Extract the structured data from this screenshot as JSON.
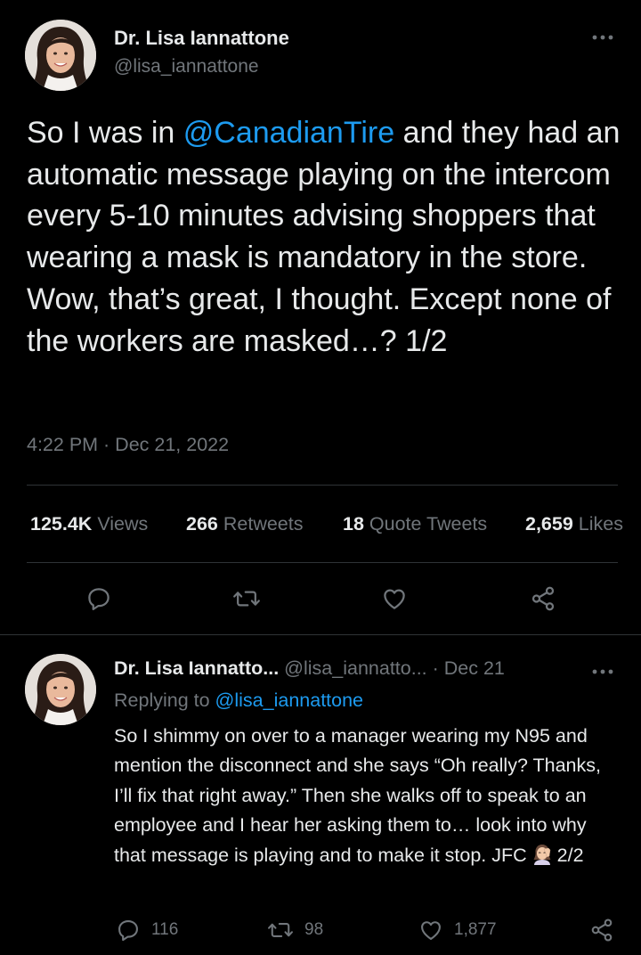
{
  "main_tweet": {
    "author_name": "Dr. Lisa Iannattone",
    "author_handle": "@lisa_iannattone",
    "more_icon": "more-horizontal-icon",
    "text_before": "So I was in ",
    "mention": "@CanadianTire",
    "text_after": " and they had an automatic message playing on the intercom every 5-10 minutes advising shoppers that wearing a mask is mandatory in the store. Wow, that’s great, I thought. Except none of the workers are masked…? 1/2",
    "timestamp": "4:22 PM · Dec 21, 2022",
    "stats": {
      "views_count": "125.4K",
      "views_label": "Views",
      "retweets_count": "266",
      "retweets_label": "Retweets",
      "quotes_count": "18",
      "quotes_label": "Quote Tweets",
      "likes_count": "2,659",
      "likes_label": "Likes"
    },
    "actions": [
      "reply-icon",
      "retweet-icon",
      "like-icon",
      "share-icon"
    ]
  },
  "reply_tweet": {
    "author_name": "Dr. Lisa Iannatto...",
    "author_handle": "@lisa_iannatto...",
    "separator": " · ",
    "date": "Dec 21",
    "replying_label": "Replying to ",
    "replying_handle": "@lisa_iannattone",
    "text_before_emoji": "So I shimmy on over to a manager wearing my N95 and mention the disconnect and she says “Oh really? Thanks, I’ll fix that right away.” Then she walks off to speak to an employee and I hear her asking them to… look into why that message is playing and to make it stop. JFC",
    "emoji": "woman-facepalming-emoji",
    "text_after_emoji": "2/2",
    "replies_count": "116",
    "retweets_count": "98",
    "likes_count": "1,877"
  },
  "colors": {
    "background": "#000000",
    "text": "#e7e9ea",
    "secondary": "#71767b",
    "link": "#1d9bf0",
    "divider": "#2f3336"
  }
}
